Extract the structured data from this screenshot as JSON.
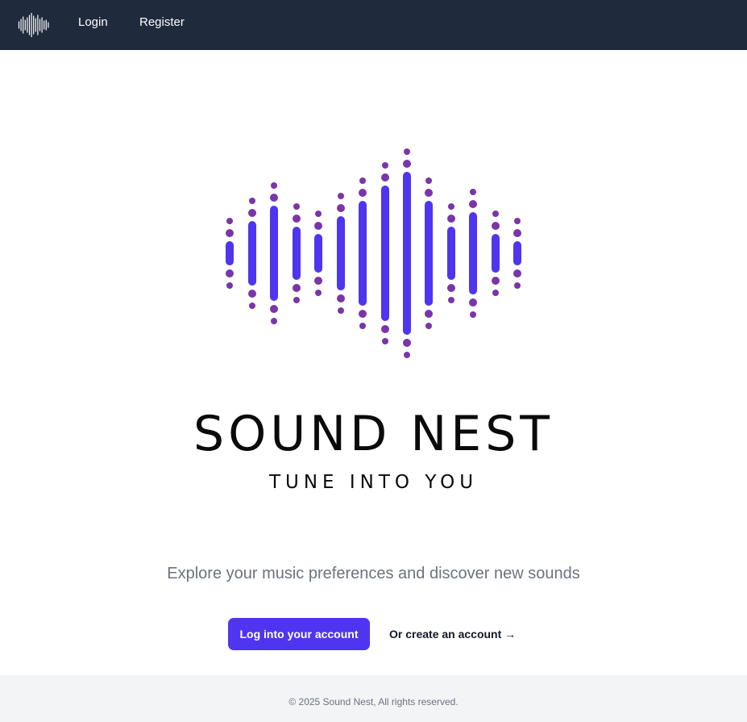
{
  "nav": {
    "logo_icon": "sound-wave-icon",
    "login_label": "Login",
    "register_label": "Register"
  },
  "hero": {
    "logo_icon": "sound-wave-logo-icon",
    "title": "SOUND NEST",
    "tagline": "TUNE INTO YOU",
    "subtitle": "Explore your music preferences and discover new sounds",
    "login_button": "Log into your account",
    "register_link": "Or create an account →"
  },
  "footer": {
    "copyright": "© 2025 Sound Nest, All rights reserved."
  },
  "colors": {
    "nav_bg": "#1f2a3d",
    "accent": "#4f35f0",
    "dots": "#7a35a8",
    "footer_bg": "#f3f4f6",
    "muted_text": "#6b7280"
  }
}
